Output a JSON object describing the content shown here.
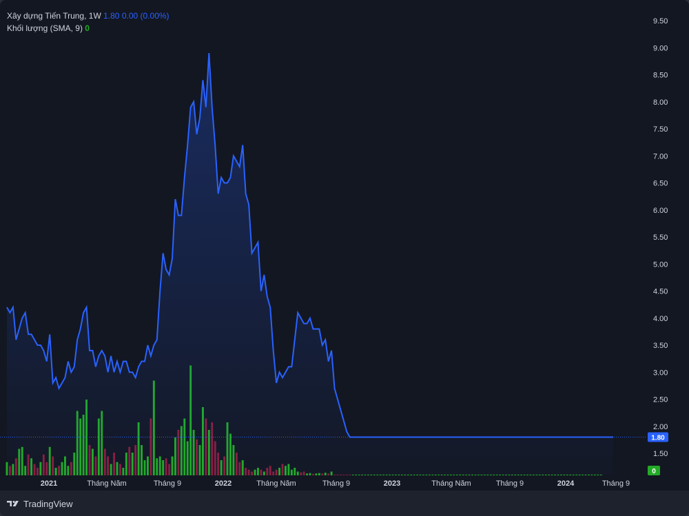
{
  "legend": {
    "symbol": "Xây dựng Tiến Trung, 1W",
    "last": "1.80",
    "change": "0.00",
    "change_pct": "(0.00%)",
    "volume_label": "Khối lượng (SMA, 9)",
    "volume_value": "0"
  },
  "footer": {
    "brand": "TradingView"
  },
  "colors": {
    "background": "#131722",
    "price_line": "#2962ff",
    "volume_up": "#22ab26",
    "volume_down": "#8b1e3f",
    "text": "#d1d4dc"
  },
  "chart_data": {
    "type": "line",
    "title": "Xây dựng Tiến Trung, 1W",
    "interval": "1W",
    "y_axis": {
      "position": "right",
      "ticks": [
        "9.50",
        "9.00",
        "8.50",
        "8.00",
        "7.50",
        "7.00",
        "6.50",
        "6.00",
        "5.50",
        "5.00",
        "4.50",
        "4.00",
        "3.50",
        "3.00",
        "2.50",
        "2.00",
        "1.50"
      ],
      "ylim": [
        1.3,
        9.6
      ]
    },
    "x_axis": {
      "ticks": [
        {
          "label": "2021",
          "bold": true
        },
        {
          "label": "Tháng Năm",
          "bold": false
        },
        {
          "label": "Tháng 9",
          "bold": false
        },
        {
          "label": "2022",
          "bold": true
        },
        {
          "label": "Tháng Năm",
          "bold": false
        },
        {
          "label": "Tháng 9",
          "bold": false
        },
        {
          "label": "2023",
          "bold": true
        },
        {
          "label": "Tháng Năm",
          "bold": false
        },
        {
          "label": "Tháng 9",
          "bold": false
        },
        {
          "label": "2024",
          "bold": true
        },
        {
          "label": "Tháng 9",
          "bold": false
        }
      ]
    },
    "price_series": {
      "name": "Xây dựng Tiến Trung",
      "approx_weekly_close": [
        4.2,
        4.1,
        4.2,
        3.6,
        3.8,
        4.0,
        4.1,
        3.7,
        3.7,
        3.6,
        3.5,
        3.5,
        3.4,
        3.2,
        3.7,
        2.8,
        2.9,
        2.7,
        2.8,
        2.9,
        3.2,
        3.0,
        3.1,
        3.6,
        3.8,
        4.1,
        4.2,
        3.4,
        3.4,
        3.1,
        3.3,
        3.4,
        3.3,
        3.0,
        3.3,
        3.0,
        3.2,
        3.0,
        3.2,
        3.2,
        3.0,
        3.0,
        2.9,
        3.1,
        3.2,
        3.2,
        3.5,
        3.3,
        3.5,
        3.6,
        4.5,
        5.2,
        4.9,
        4.8,
        5.1,
        6.2,
        5.9,
        5.9,
        6.6,
        7.2,
        7.9,
        8.0,
        7.4,
        7.7,
        8.4,
        7.9,
        8.9,
        7.9,
        7.2,
        6.3,
        6.6,
        6.5,
        6.5,
        6.6,
        7.0,
        6.9,
        6.8,
        7.2,
        6.3,
        6.1,
        5.2,
        5.3,
        5.4,
        4.5,
        4.8,
        4.4,
        4.2,
        3.4,
        2.8,
        3.0,
        2.9,
        3.0,
        3.1,
        3.1,
        3.6,
        4.1,
        4.0,
        3.9,
        3.9,
        4.0,
        3.8,
        3.8,
        3.8,
        3.5,
        3.6,
        3.2,
        3.4,
        2.7,
        2.5,
        2.3,
        2.1,
        1.9,
        1.8,
        1.8,
        1.8,
        1.8,
        1.8,
        1.8,
        1.8,
        1.8,
        1.8,
        1.8,
        1.8,
        1.8,
        1.8,
        1.8,
        1.8,
        1.8,
        1.8,
        1.8,
        1.8,
        1.8,
        1.8,
        1.8,
        1.8,
        1.8,
        1.8,
        1.8,
        1.8,
        1.8,
        1.8,
        1.8,
        1.8,
        1.8,
        1.8,
        1.8,
        1.8,
        1.8,
        1.8,
        1.8,
        1.8,
        1.8,
        1.8,
        1.8,
        1.8,
        1.8,
        1.8,
        1.8,
        1.8,
        1.8,
        1.8,
        1.8,
        1.8,
        1.8,
        1.8,
        1.8,
        1.8,
        1.8,
        1.8,
        1.8,
        1.8,
        1.8,
        1.8,
        1.8,
        1.8,
        1.8,
        1.8,
        1.8,
        1.8,
        1.8,
        1.8,
        1.8,
        1.8,
        1.8,
        1.8,
        1.8,
        1.8,
        1.8,
        1.8,
        1.8,
        1.8,
        1.8,
        1.8,
        1.8,
        1.8,
        1.8,
        1.8,
        1.8,
        1.8
      ],
      "last_value_label": "1.80"
    },
    "volume_series": {
      "name": "Khối lượng (SMA, 9)",
      "last_value_label": "0",
      "relative_volume": [
        0.35,
        0.25,
        0.3,
        0.45,
        0.7,
        0.75,
        0.25,
        0.55,
        0.45,
        0.3,
        0.2,
        0.35,
        0.55,
        0.35,
        0.75,
        0.5,
        0.2,
        0.25,
        0.35,
        0.5,
        0.25,
        0.35,
        0.6,
        1.7,
        1.5,
        1.6,
        2.0,
        0.8,
        0.7,
        0.5,
        1.5,
        1.7,
        0.7,
        0.5,
        0.3,
        0.6,
        0.35,
        0.3,
        0.2,
        0.6,
        0.75,
        0.6,
        0.8,
        1.4,
        0.8,
        0.4,
        0.5,
        1.5,
        2.5,
        0.45,
        0.5,
        0.4,
        0.45,
        0.3,
        0.5,
        1.0,
        1.2,
        1.3,
        1.5,
        0.9,
        2.9,
        1.2,
        0.95,
        0.8,
        1.8,
        1.5,
        1.2,
        1.4,
        0.9,
        0.6,
        0.4,
        0.5,
        1.4,
        1.1,
        0.8,
        0.6,
        0.35,
        0.4,
        0.2,
        0.15,
        0.1,
        0.15,
        0.2,
        0.15,
        0.1,
        0.2,
        0.25,
        0.1,
        0.15,
        0.2,
        0.3,
        0.25,
        0.3,
        0.15,
        0.2,
        0.1,
        0.08,
        0.1,
        0.05,
        0.06,
        0.04,
        0.05,
        0.06,
        0.05,
        0.07,
        0.05,
        0.1,
        0.02,
        0.02,
        0.02,
        0.02,
        0.02,
        0.02,
        0.02,
        0.02,
        0.02,
        0.02,
        0.02,
        0.02,
        0.02,
        0.02,
        0.02,
        0.02,
        0.02,
        0.02,
        0.02,
        0.02,
        0.02,
        0.02,
        0.02,
        0.02,
        0.02,
        0.02,
        0.02,
        0.02,
        0.02,
        0.02,
        0.02,
        0.02,
        0.02,
        0.02,
        0.02,
        0.02,
        0.02,
        0.02,
        0.02,
        0.02,
        0.02,
        0.02,
        0.02,
        0.02,
        0.02,
        0.02,
        0.02,
        0.02,
        0.02,
        0.02,
        0.02,
        0.02,
        0.02,
        0.02,
        0.02,
        0.02,
        0.02,
        0.02,
        0.02,
        0.02,
        0.02,
        0.02,
        0.02,
        0.02,
        0.02,
        0.02,
        0.02,
        0.02,
        0.02,
        0.02,
        0.02,
        0.02,
        0.02,
        0.02,
        0.02,
        0.02,
        0.02,
        0.02,
        0.02,
        0.02,
        0.02,
        0.02,
        0.02,
        0.02,
        0.02,
        0.02,
        0.02,
        0.02
      ]
    },
    "grid": false,
    "legend_position": "top-left"
  }
}
